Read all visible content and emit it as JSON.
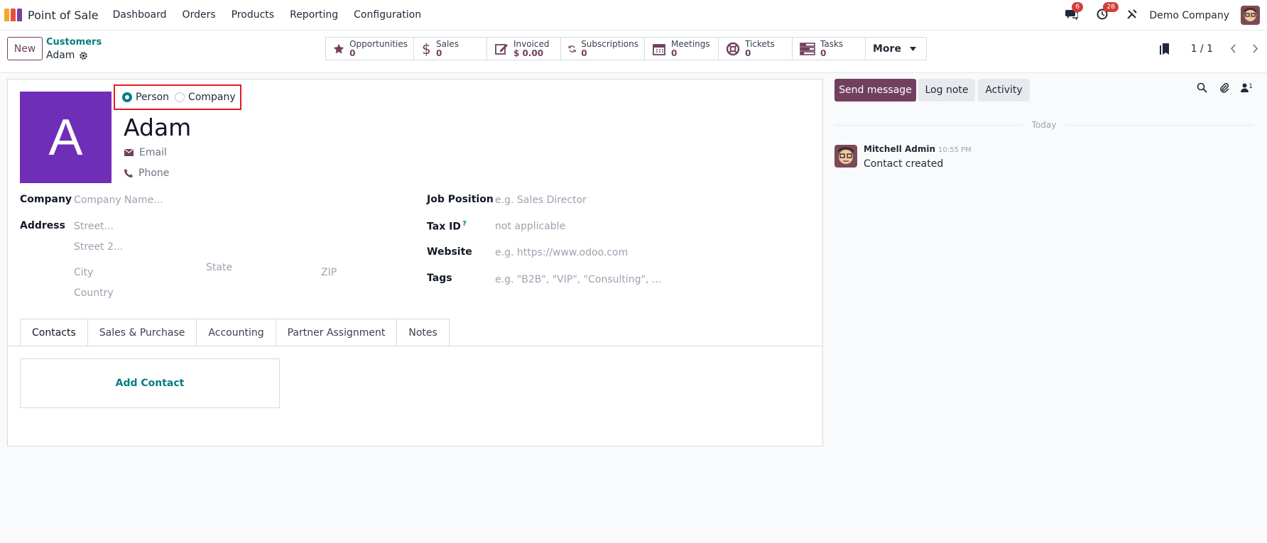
{
  "nav": {
    "app_name": "Point of Sale",
    "menu": [
      "Dashboard",
      "Orders",
      "Products",
      "Reporting",
      "Configuration"
    ],
    "messages_badge": "6",
    "activities_badge": "28",
    "company": "Demo Company"
  },
  "control": {
    "new_label": "New",
    "breadcrumb_parent": "Customers",
    "breadcrumb_current": "Adam",
    "smart_buttons": [
      {
        "icon": "star-icon",
        "label": "Opportunities",
        "value": "0"
      },
      {
        "icon": "dollar-icon",
        "label": "Sales",
        "value": "0"
      },
      {
        "icon": "pencil-square-icon",
        "label": "Invoiced",
        "value": "$ 0.00"
      },
      {
        "icon": "refresh-icon",
        "label": "Subscriptions",
        "value": "0"
      },
      {
        "icon": "calendar-icon",
        "label": "Meetings",
        "value": "0"
      },
      {
        "icon": "life-ring-icon",
        "label": "Tickets",
        "value": "0"
      },
      {
        "icon": "tasks-icon",
        "label": "Tasks",
        "value": "0"
      }
    ],
    "more_label": "More",
    "pager_value": "1 / 1"
  },
  "form": {
    "avatar_letter": "A",
    "type_person": "Person",
    "type_company": "Company",
    "name": "Adam",
    "email_placeholder": "Email",
    "phone_placeholder": "Phone",
    "company_label": "Company",
    "company_placeholder": "Company Name...",
    "address_label": "Address",
    "street_placeholder": "Street...",
    "street2_placeholder": "Street 2...",
    "city_placeholder": "City",
    "state_placeholder": "State",
    "zip_placeholder": "ZIP",
    "country_placeholder": "Country",
    "job_label": "Job Position",
    "job_placeholder": "e.g. Sales Director",
    "tax_label": "Tax ID",
    "tax_help": "?",
    "tax_value": "not applicable",
    "website_label": "Website",
    "website_placeholder": "e.g. https://www.odoo.com",
    "tags_label": "Tags",
    "tags_placeholder": "e.g. \"B2B\", \"VIP\", \"Consulting\", ...",
    "tabs": [
      "Contacts",
      "Sales & Purchase",
      "Accounting",
      "Partner Assignment",
      "Notes"
    ],
    "add_contact": "Add Contact"
  },
  "chatter": {
    "send_message": "Send message",
    "log_note": "Log note",
    "activity": "Activity",
    "followers_count": "1",
    "day_label": "Today",
    "author": "Mitchell Admin",
    "time": "10:55 PM",
    "message": "Contact created"
  },
  "colors": {
    "brand": "#71405f",
    "teal": "#017e84",
    "avatar_bg": "#6f2eb7",
    "highlight": "#e11b22",
    "badge": "#d23f3a"
  }
}
